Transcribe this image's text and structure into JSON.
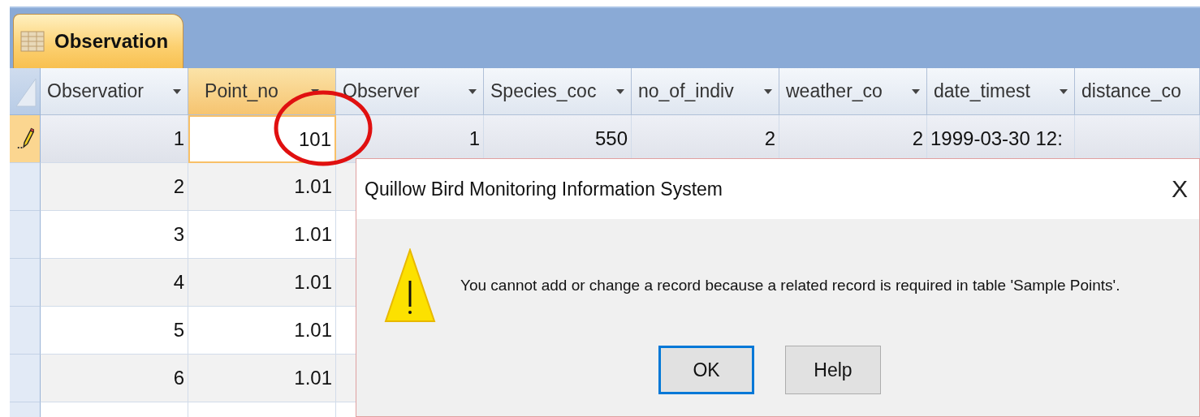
{
  "tab": {
    "label": "Observation",
    "selected": true
  },
  "columns": [
    {
      "label": "Observatior",
      "selected": false,
      "kind": "number"
    },
    {
      "label": "Point_no",
      "selected": true,
      "kind": "number"
    },
    {
      "label": "Observer",
      "selected": false,
      "kind": "number"
    },
    {
      "label": "Species_coc",
      "selected": false,
      "kind": "number"
    },
    {
      "label": "no_of_indiv",
      "selected": false,
      "kind": "number"
    },
    {
      "label": "weather_co",
      "selected": false,
      "kind": "number"
    },
    {
      "label": "date_timest",
      "selected": false,
      "kind": "date"
    },
    {
      "label": "distance_co",
      "selected": false,
      "kind": "text"
    }
  ],
  "rows": [
    {
      "editing": true,
      "cells": [
        "1",
        "101",
        "1",
        "550",
        "2",
        "2",
        "1999-03-30 12:"
      ]
    },
    {
      "editing": false,
      "cells": [
        "2",
        "1.01"
      ]
    },
    {
      "editing": false,
      "cells": [
        "3",
        "1.01"
      ]
    },
    {
      "editing": false,
      "cells": [
        "4",
        "1.01"
      ]
    },
    {
      "editing": false,
      "cells": [
        "5",
        "1.01"
      ]
    },
    {
      "editing": false,
      "cells": [
        "6",
        "1.01"
      ]
    }
  ],
  "dialog": {
    "title": "Quillow Bird Monitoring Information System",
    "close": "X",
    "message": "You cannot add or change a record because a related record is required in table 'Sample Points'.",
    "buttons": [
      {
        "label": "OK",
        "default": true
      },
      {
        "label": "Help",
        "default": false
      }
    ]
  }
}
